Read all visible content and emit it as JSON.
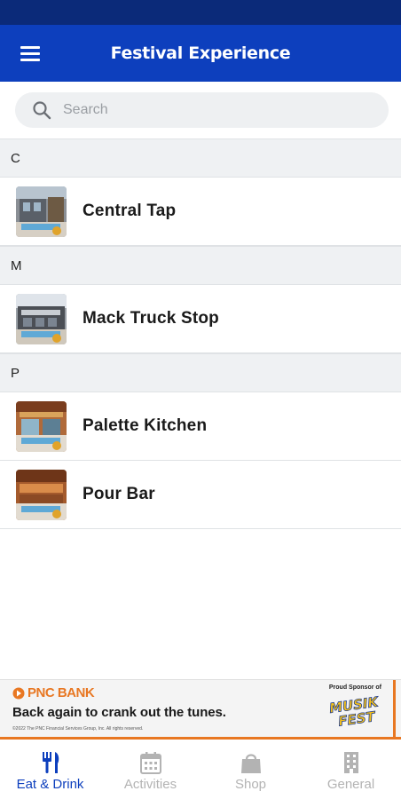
{
  "app_bar": {
    "title": "Festival Experience",
    "color": "#0d3fbd"
  },
  "search": {
    "placeholder": "Search"
  },
  "sections": [
    {
      "letter": "C",
      "items": [
        {
          "label": "Central Tap",
          "icon": "venue-photo"
        }
      ]
    },
    {
      "letter": "M",
      "items": [
        {
          "label": "Mack Truck Stop",
          "icon": "venue-photo"
        }
      ]
    },
    {
      "letter": "P",
      "items": [
        {
          "label": "Palette Kitchen",
          "icon": "venue-photo"
        },
        {
          "label": "Pour Bar",
          "icon": "venue-photo"
        }
      ]
    }
  ],
  "ad": {
    "brand": "PNC BANK",
    "headline": "Back again to crank out the tunes.",
    "legal": "©2022 The PNC Financial Services Group, Inc. All rights reserved.",
    "sponsor_text": "Proud Sponsor of",
    "event_logo": "MUSIK FEST",
    "accent": "#e87722"
  },
  "bottom_nav": [
    {
      "label": "Eat & Drink",
      "icon": "fork-knife-icon",
      "active": true
    },
    {
      "label": "Activities",
      "icon": "calendar-icon",
      "active": false
    },
    {
      "label": "Shop",
      "icon": "shopping-bag-icon",
      "active": false
    },
    {
      "label": "General",
      "icon": "building-icon",
      "active": false
    }
  ]
}
